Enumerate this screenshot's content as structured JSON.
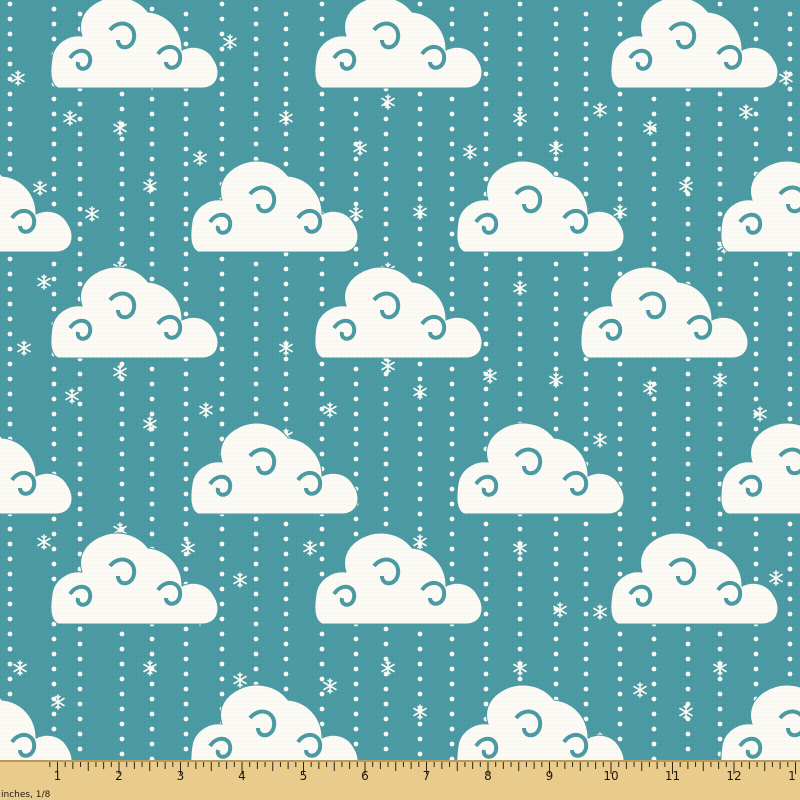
{
  "fabric": {
    "background_color": "#4b9aa3",
    "cloud_color": "#fbfaf4",
    "snowflake_color": "#fbfaf4",
    "dot_color": "#fbfaf4",
    "motifs": [
      "cloud-icon",
      "snowflake-icon",
      "snow-dot"
    ]
  },
  "ruler": {
    "unit_label": "inches, 1/8",
    "numbers": [
      "1",
      "2",
      "3",
      "4",
      "5",
      "6",
      "7",
      "8",
      "9",
      "10",
      "11",
      "12",
      "1"
    ],
    "background_color": "#e9cc8c"
  }
}
